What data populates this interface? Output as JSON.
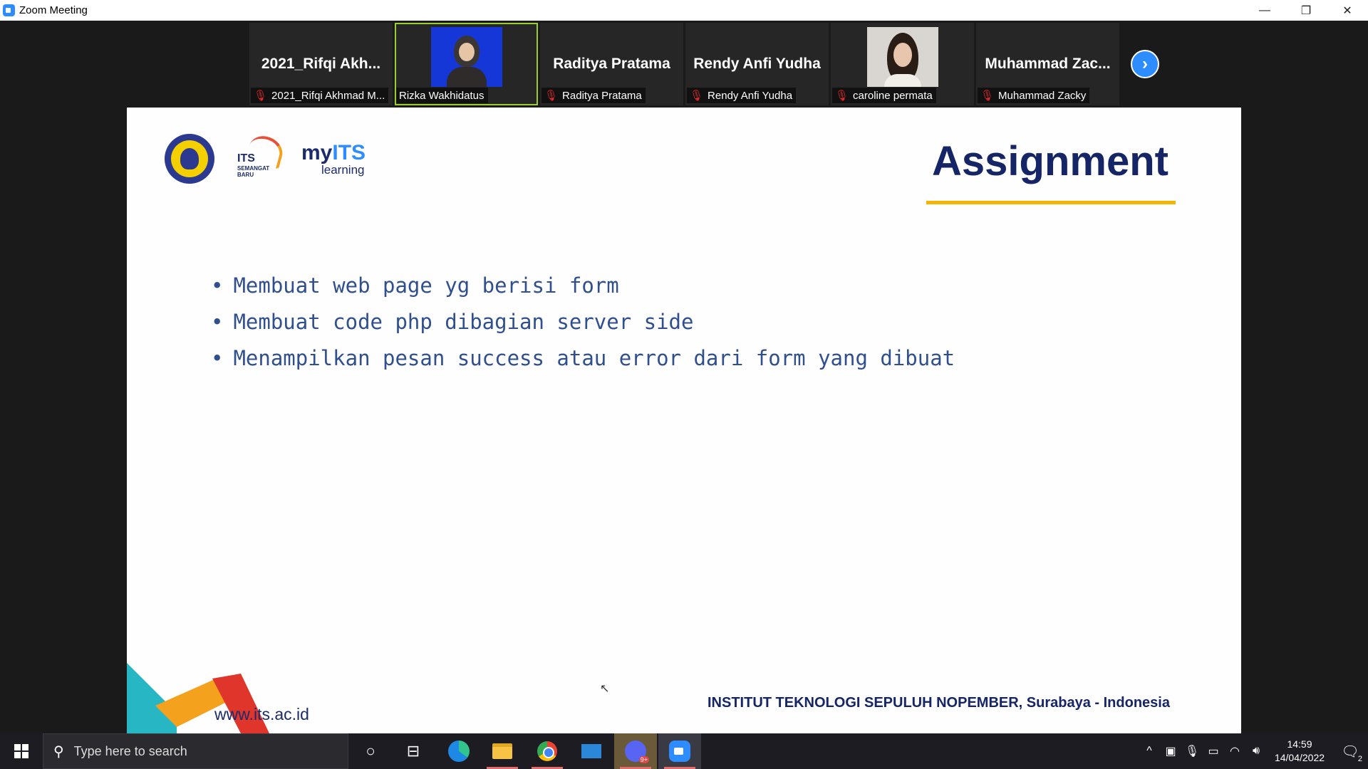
{
  "window": {
    "title": "Zoom Meeting",
    "controls": {
      "minimize": "—",
      "restore": "❐",
      "close": "✕"
    }
  },
  "participants": [
    {
      "big_name": "2021_Rifqi  Akh...",
      "label": "2021_Rifqi Akhmad M...",
      "muted": true,
      "video": false
    },
    {
      "big_name": "",
      "label": "Rizka Wakhidatus",
      "muted": false,
      "video": true,
      "active": true
    },
    {
      "big_name": "Raditya Pratama",
      "label": "Raditya Pratama",
      "muted": true,
      "video": false
    },
    {
      "big_name": "Rendy Anfi Yudha",
      "label": "Rendy Anfi Yudha",
      "muted": true,
      "video": false
    },
    {
      "big_name": "",
      "label": "caroline permata",
      "muted": true,
      "video": true
    },
    {
      "big_name": "Muhammad  Zac...",
      "label": "Muhammad Zacky",
      "muted": true,
      "video": false
    }
  ],
  "next_button": "›",
  "slide": {
    "logos": {
      "semangat_line1": "ITS",
      "semangat_line2": "SEMANGAT BARU",
      "myits_prefix": "my",
      "myits_brand": "ITS",
      "myits_sub": "learning"
    },
    "title": "Assignment",
    "bullets": [
      "Membuat web page yg berisi form",
      "Membuat code php dibagian server side",
      "Menampilkan pesan success atau error dari form yang dibuat"
    ],
    "bullet_symbol": "•",
    "url": "www.its.ac.id",
    "institute": "INSTITUT TEKNOLOGI SEPULUH NOPEMBER, Surabaya - Indonesia"
  },
  "taskbar": {
    "search_placeholder": "Type here to search",
    "discord_badge": "9+",
    "clock_time": "14:59",
    "clock_date": "14/04/2022",
    "notification_count": "2"
  },
  "colors": {
    "accent_blue": "#2d8cff",
    "slide_title": "#152566",
    "underline": "#f4b400",
    "bullet_text": "#2f4f8f",
    "muted_icon": "#e02828"
  }
}
